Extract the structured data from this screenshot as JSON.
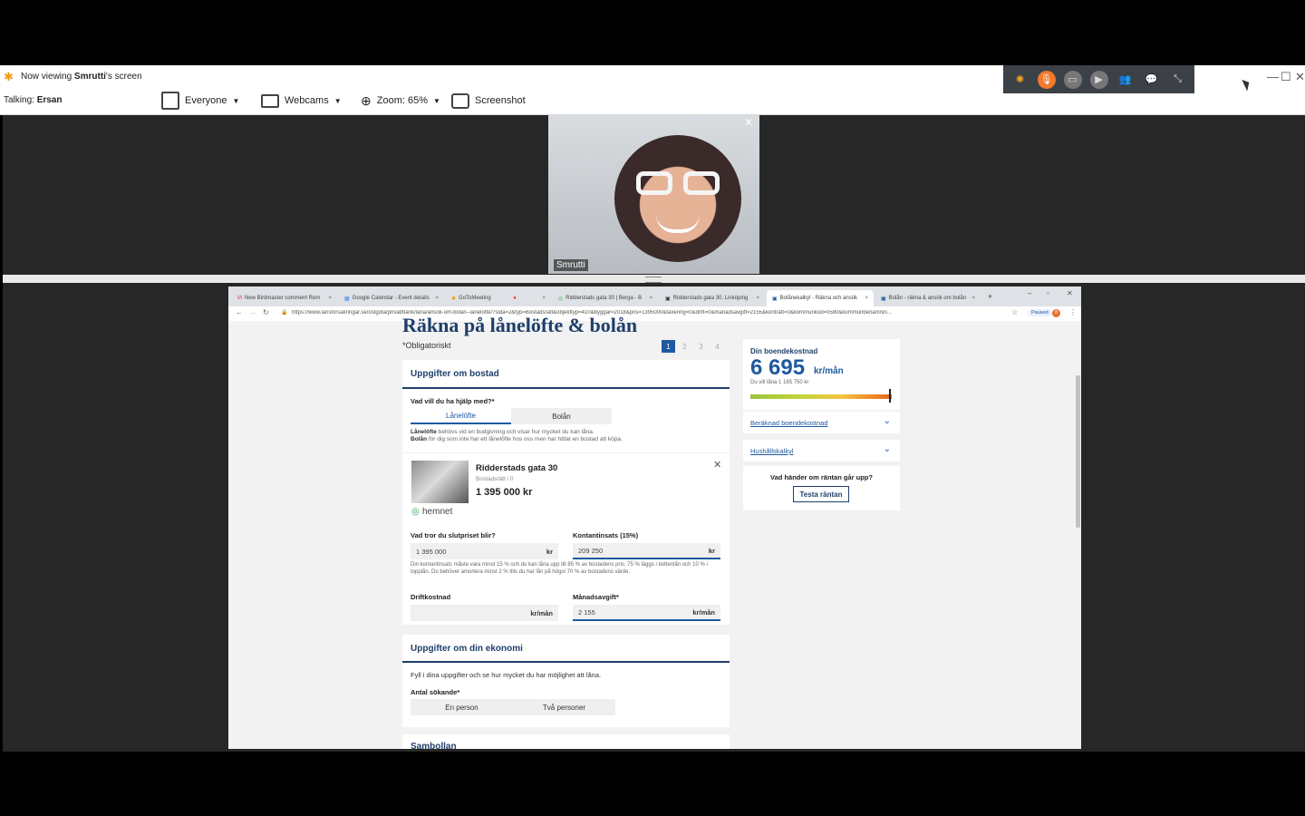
{
  "app": {
    "viewing_prefix": "Now viewing ",
    "viewing_name": "Smrutti",
    "viewing_suffix": "'s screen",
    "talking_label": "Talking:",
    "talking_name": "Ersan",
    "toolbar": {
      "everyone": "Everyone",
      "webcams": "Webcams",
      "zoom": "Zoom: 65%",
      "screenshot": "Screenshot"
    },
    "window_controls": [
      "—",
      "☐",
      "✕"
    ]
  },
  "video": {
    "participant": "Smrutti",
    "close": "✕"
  },
  "browser": {
    "tabs": [
      {
        "label": "New Birdmaster comment Rem",
        "close": "×"
      },
      {
        "label": "Google Calendar - Event details",
        "close": "×"
      },
      {
        "label": "GoToMeeting",
        "close": "×"
      },
      {
        "label": "Ridderstads gata 30 | Berga - B",
        "close": "×"
      },
      {
        "label": "Ridderstads gata 30, Linköping",
        "close": "×"
      },
      {
        "label": "Bolånekalkyl - Räkna och ansök",
        "close": "×"
      },
      {
        "label": "Bolån - räkna & ansök om bolån",
        "close": "×"
      }
    ],
    "new_tab": "+",
    "url": "https://www.lansforsakringar.se/ostgota/privat/bank/lana/ansok-om-bolan--laneloftе/?sida=2&typ=Bostadsratt&objekttyp=410&byggar=2018&pris=1395000&taxering=0&drift=0&manadsavgift=2155&kontratt=0&kommunkod=0580&kommunbenamnin...",
    "paused": "Paused",
    "paused_count": "8"
  },
  "page": {
    "heading": "Räkna på lånelöfte & bolån",
    "obligatory": "*Obligatoriskt",
    "steps": [
      "1",
      "2",
      "3",
      "4"
    ],
    "bostad": {
      "title": "Uppgifter om bostad",
      "help_label": "Vad vill du ha hjälp med?*",
      "option_loan_promise": "Lånelöfte",
      "option_mortgage": "Bolån",
      "desc_1_bold": "Lånelöfte",
      "desc_1": " behövs vid en budgivning och visar hur mycket du kan låna.",
      "desc_2_bold": "Bolån",
      "desc_2": " för dig som inte har ett lånelöfte hos oss men har hittat en bostad att köpa.",
      "listing_title": "Ridderstads gata 30",
      "listing_sub": "Bostadsrätt i 0",
      "listing_price": "1 395 000 kr",
      "listing_source": "hemnet",
      "final_price_label": "Vad tror du slutpriset blir?",
      "final_price_value": "1 395 000",
      "final_price_unit": "kr",
      "down_payment_label": "Kontantinsats (15%)",
      "down_payment_value": "209 250",
      "down_payment_unit": "kr",
      "down_payment_info": "Din kontantinsats måste vara minst 15 % och du kan låna upp till 85 % av bostadens pris. 75 % läggs i bottenlån och 10 % i topplån. Du behöver amortera minst 2 % tills du har lån på högst 70 % av bostadens värde.",
      "operating_label": "Driftkostnad",
      "operating_value": "",
      "operating_unit": "kr/mån",
      "monthly_fee_label": "Månadsavgift*",
      "monthly_fee_value": "2 155",
      "monthly_fee_unit": "kr/mån"
    },
    "ekonomi": {
      "title": "Uppgifter om din ekonomi",
      "intro": "Fyll i dina uppgifter och se hur mycket du har möjlighet att låna.",
      "applicants_label": "Antal sökande*",
      "option_one": "En person",
      "option_two": "Två personer"
    },
    "next_section": "Sambollan"
  },
  "side": {
    "cost_title": "Din boendekostnad",
    "cost_value": "6 695",
    "cost_unit": "kr/mån",
    "cost_sub": "Du vill låna 1 185 750 kr",
    "cost_level": 0.99,
    "accordion_1": "Beräknad boendekostnad",
    "accordion_2": "Hushållskalkyl",
    "rate_question": "Vad händer om räntan går upp?",
    "rate_button": "Testa räntan"
  }
}
